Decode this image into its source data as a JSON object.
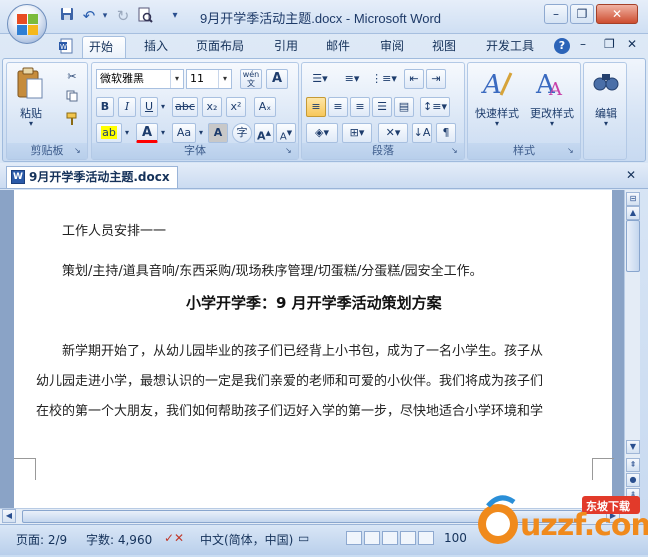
{
  "window": {
    "title": "9月开学季活动主题.docx - Microsoft Word",
    "minimize": "–",
    "restore": "❐",
    "close": "✕"
  },
  "quick_access": {
    "save_icon": "save-icon",
    "undo": "↶",
    "redo": "↻",
    "customize": "▾"
  },
  "ribbon": {
    "tabs": [
      {
        "label": "开始",
        "active": true
      },
      {
        "label": "插入"
      },
      {
        "label": "页面布局"
      },
      {
        "label": "引用"
      },
      {
        "label": "邮件"
      },
      {
        "label": "审阅"
      },
      {
        "label": "视图"
      },
      {
        "label": "开发工具"
      }
    ],
    "help": "?",
    "clipboard": {
      "paste_label": "粘贴",
      "group_label": "剪贴板"
    },
    "font": {
      "font_name": "微软雅黑",
      "font_size": "11",
      "group_label": "字体",
      "bold": "B",
      "italic": "I",
      "underline": "U",
      "strike": "abc",
      "subscript": "x₂",
      "superscript": "x²",
      "case": "Aa",
      "grow": "A",
      "shrink": "A",
      "clear": "Aₓ",
      "phonetic": "wén",
      "char_border": "A",
      "char_shading": "A",
      "enclose": "字",
      "highlight": "ab",
      "font_color": "A"
    },
    "paragraph": {
      "group_label": "段落"
    },
    "styles": {
      "quick_styles": "快速样式",
      "change_styles": "更改样式",
      "group_label": "样式"
    },
    "editing": {
      "label": "编辑"
    }
  },
  "document": {
    "tab_label": "9月开学季活动主题.docx",
    "lines": [
      "工作人员安排一一",
      "策划/主持/道具音响/东西采购/现场秩序管理/切蛋糕/分蛋糕/园安全工作。",
      "小学开学季：9 月开学季活动策划方案",
      "新学期开始了，从幼儿园毕业的孩子们已经背上小书包，成为了一名小学生。孩子从",
      "幼儿园走进小学，最想认识的一定是我们亲爱的老师和可爱的小伙伴。我们将成为孩子们",
      "在校的第一个大朋友，我们如何帮助孩子们迈好入学的第一步，尽快地适合小学环境和学"
    ]
  },
  "statusbar": {
    "page": "页面: 2/9",
    "words": "字数: 4,960",
    "language": "中文(简体，中国)",
    "zoom": "100"
  },
  "watermark": {
    "text": "uzzf.com",
    "tag": "东坡下载"
  },
  "colors": {
    "accent": "#2b5aa8",
    "highlight": "#ffff00",
    "font_color": "#ff0000",
    "watermark_orange": "#f08a1c"
  }
}
